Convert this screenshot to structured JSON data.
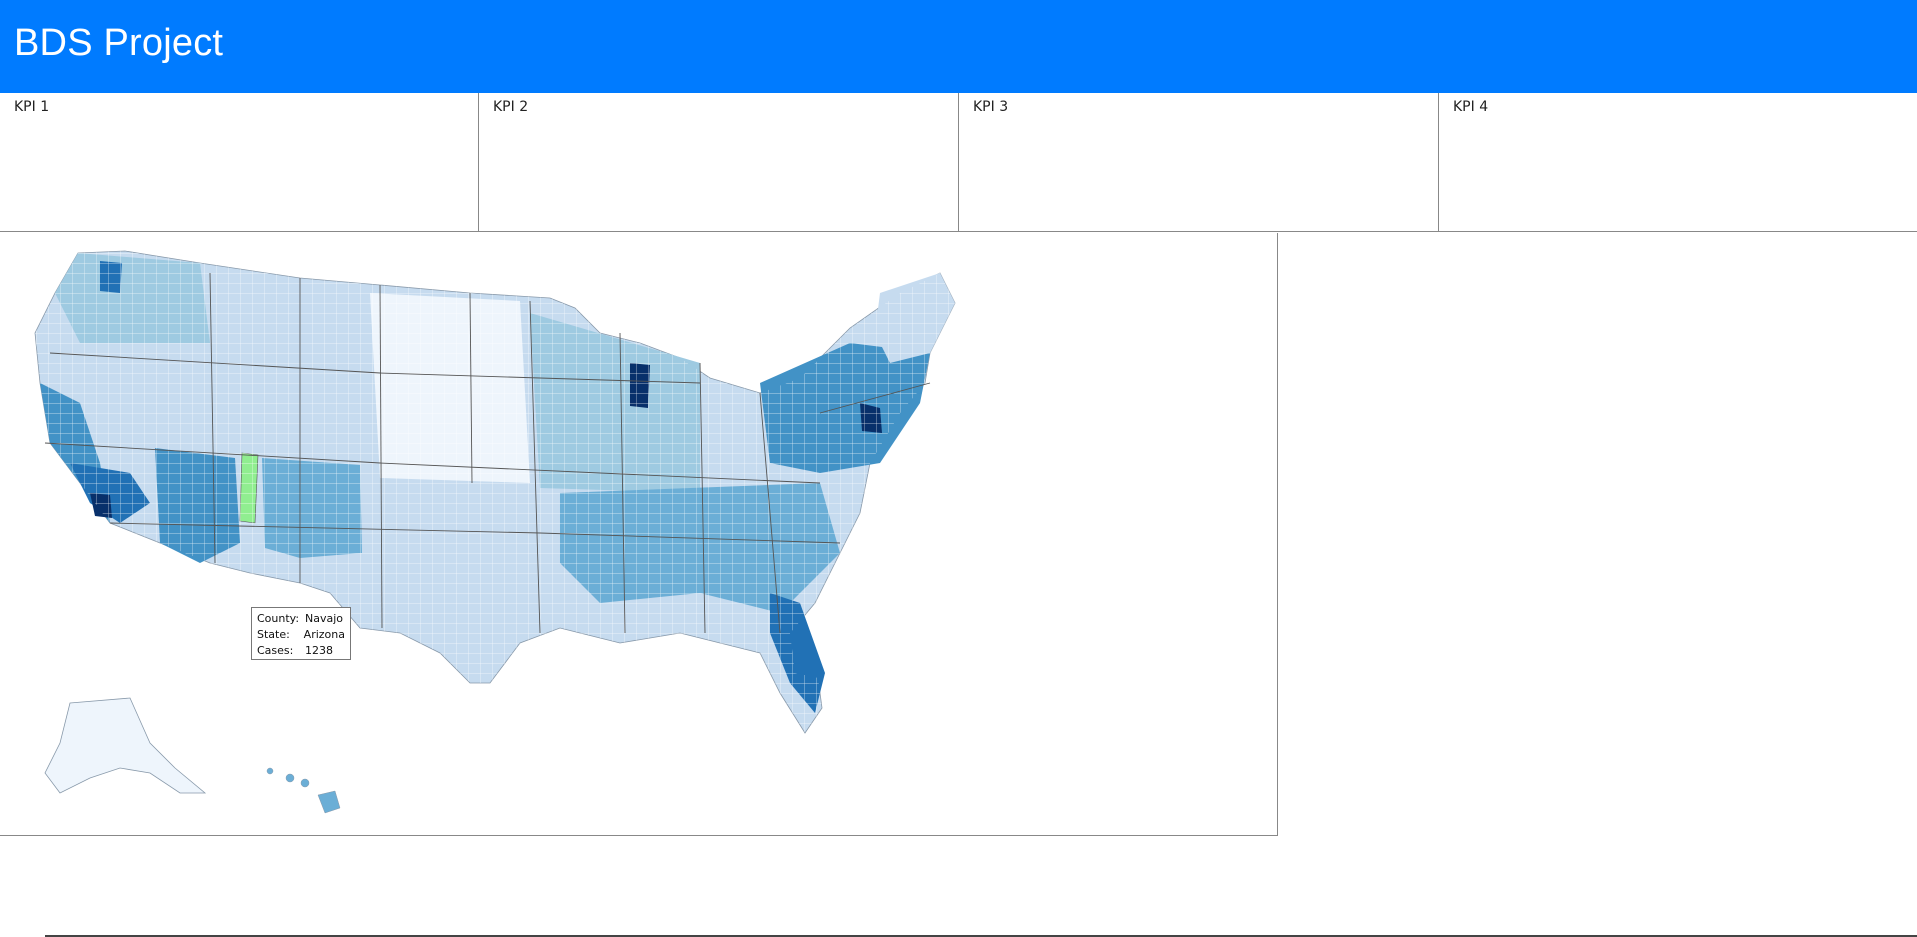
{
  "header": {
    "title": "BDS Project"
  },
  "kpis": [
    {
      "label": "KPI 1"
    },
    {
      "label": "KPI 2"
    },
    {
      "label": "KPI 3"
    },
    {
      "label": "KPI 4"
    }
  ],
  "map": {
    "tooltip": {
      "county_label": "County:",
      "county_value": "Navajo",
      "state_label": "State:",
      "state_value": "Arizona",
      "cases_label": "Cases:",
      "cases_value": "1238"
    },
    "colors": {
      "lightest": "#eef5fc",
      "light": "#c6dbef",
      "mid": "#6baed6",
      "dark": "#2171b5",
      "darkest": "#08306b",
      "highlight": "#90ee90",
      "state_border": "#555555"
    }
  }
}
